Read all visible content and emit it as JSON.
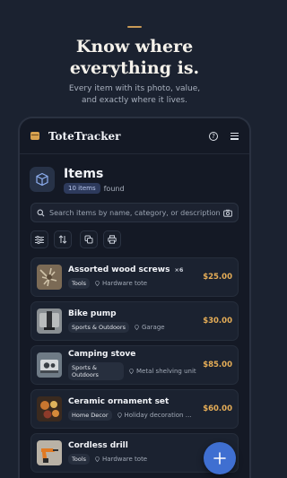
{
  "hero": {
    "headline_line1": "Know where",
    "headline_line2": "everything is.",
    "sub_line1": "Every item with its photo, value,",
    "sub_line2": "and exactly where it lives."
  },
  "app": {
    "title": "ToteTracker",
    "help_icon": "?",
    "accent": "#d7a14f"
  },
  "items_header": {
    "title": "Items",
    "count_badge": "10 items",
    "found_label": "found"
  },
  "search": {
    "placeholder": "Search items by name, category, or description"
  },
  "toolbar": {
    "icons": [
      "sliders-icon",
      "sort-icon",
      "duplicate-icon",
      "print-icon"
    ]
  },
  "items": [
    {
      "name": "Assorted wood screws",
      "qty": "×6",
      "category": "Tools",
      "location": "Hardware tote",
      "price": "$25.00"
    },
    {
      "name": "Bike pump",
      "qty": "",
      "category": "Sports & Outdoors",
      "location": "Garage",
      "price": "$30.00"
    },
    {
      "name": "Camping stove",
      "qty": "",
      "category": "Sports & Outdoors",
      "location": "Metal shelving unit",
      "price": "$85.00"
    },
    {
      "name": "Ceramic ornament set",
      "qty": "",
      "category": "Home Decor",
      "location": "Holiday decoration bin",
      "price": "$60.00"
    },
    {
      "name": "Cordless drill",
      "qty": "",
      "category": "Tools",
      "location": "Hardware tote",
      "price": ""
    }
  ],
  "fab": {
    "label": "+",
    "color": "#3f6fd1"
  },
  "colors": {
    "price": "#e5ad57",
    "background": "#1b2230",
    "badge": "#2d3a5c"
  }
}
